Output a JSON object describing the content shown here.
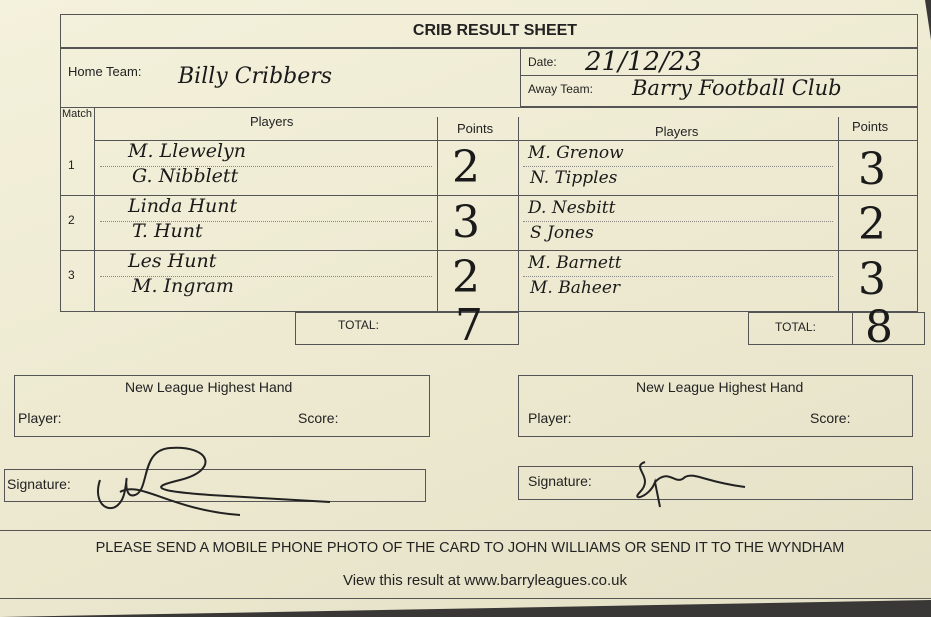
{
  "title": "CRIB RESULT SHEET",
  "home_team_label": "Home Team:",
  "home_team": "Billy Cribbers",
  "date_label": "Date:",
  "date": "21/12/23",
  "away_team_label": "Away Team:",
  "away_team": "Barry Football Club",
  "headers": {
    "match": "Match",
    "players": "Players",
    "points": "Points"
  },
  "matches": [
    {
      "n": "1",
      "home": [
        "M. Llewelyn",
        "G. Nibblett"
      ],
      "home_points": "2",
      "away": [
        "M. Grenow",
        "N. Tipples"
      ],
      "away_points": "3"
    },
    {
      "n": "2",
      "home": [
        "Linda Hunt",
        "T. Hunt"
      ],
      "home_points": "3",
      "away": [
        "D. Nesbitt",
        "S Jones"
      ],
      "away_points": "2"
    },
    {
      "n": "3",
      "home": [
        "Les Hunt",
        "M. Ingram"
      ],
      "home_points": "2",
      "away": [
        "M. Barnett",
        "M. Baheer"
      ],
      "away_points": "3"
    }
  ],
  "total_label": "TOTAL:",
  "home_total": "7",
  "away_total": "8",
  "highest_hand": {
    "title": "New League Highest Hand",
    "player": "Player:",
    "score": "Score:"
  },
  "signature_label": "Signature:",
  "footer": "PLEASE SEND A MOBILE PHONE PHOTO OF THE CARD TO JOHN WILLIAMS OR SEND IT TO THE WYNDHAM",
  "footer_link": "View this result at www.barryleagues.co.uk"
}
